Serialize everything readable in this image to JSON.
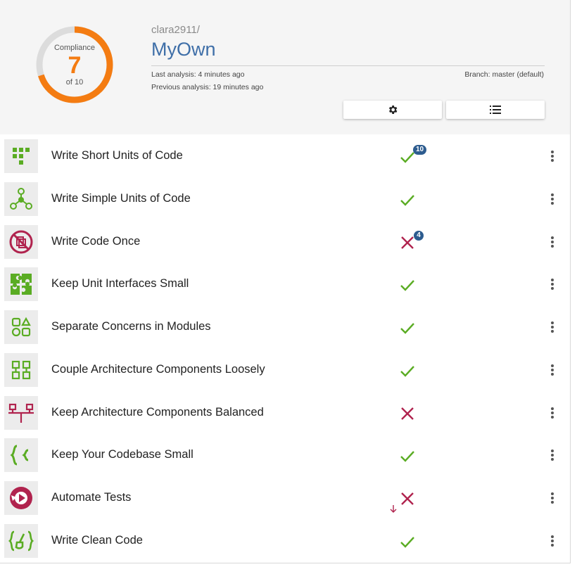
{
  "compliance": {
    "title": "Compliance",
    "value": "7",
    "of": "of 10",
    "fraction": 0.7,
    "color": "#f47c12"
  },
  "repo": {
    "owner": "clara2911/",
    "name": "MyOwn"
  },
  "analysis": {
    "last": "Last analysis: 4 minutes ago",
    "previous": "Previous analysis: 19 minutes ago",
    "branch": "Branch: master (default)"
  },
  "toolbar": {
    "settings_icon": "gear-icon",
    "list_icon": "list-icon"
  },
  "colors": {
    "pass": "#5aac23",
    "fail": "#b0234e",
    "badge": "#2d5c8f",
    "link": "#3f6fa8"
  },
  "guidelines": [
    {
      "label": "Write Short Units of Code",
      "status": "pass",
      "badge": "10",
      "icon": "short-units-icon"
    },
    {
      "label": "Write Simple Units of Code",
      "status": "pass",
      "badge": "",
      "icon": "simple-units-icon"
    },
    {
      "label": "Write Code Once",
      "status": "fail",
      "badge": "4",
      "icon": "code-once-icon"
    },
    {
      "label": "Keep Unit Interfaces Small",
      "status": "pass",
      "badge": "",
      "icon": "puzzle-icon"
    },
    {
      "label": "Separate Concerns in Modules",
      "status": "pass",
      "badge": "",
      "icon": "modules-icon"
    },
    {
      "label": "Couple Architecture Components Loosely",
      "status": "pass",
      "badge": "",
      "icon": "components-icon"
    },
    {
      "label": "Keep Architecture Components Balanced",
      "status": "fail",
      "badge": "",
      "icon": "balanced-icon"
    },
    {
      "label": "Keep Your Codebase Small",
      "status": "pass",
      "badge": "",
      "icon": "braces-icon"
    },
    {
      "label": "Automate Tests",
      "status": "fail",
      "badge": "",
      "icon": "automate-tests-icon",
      "trend": "down"
    },
    {
      "label": "Write Clean Code",
      "status": "pass",
      "badge": "",
      "icon": "clean-code-icon"
    }
  ]
}
